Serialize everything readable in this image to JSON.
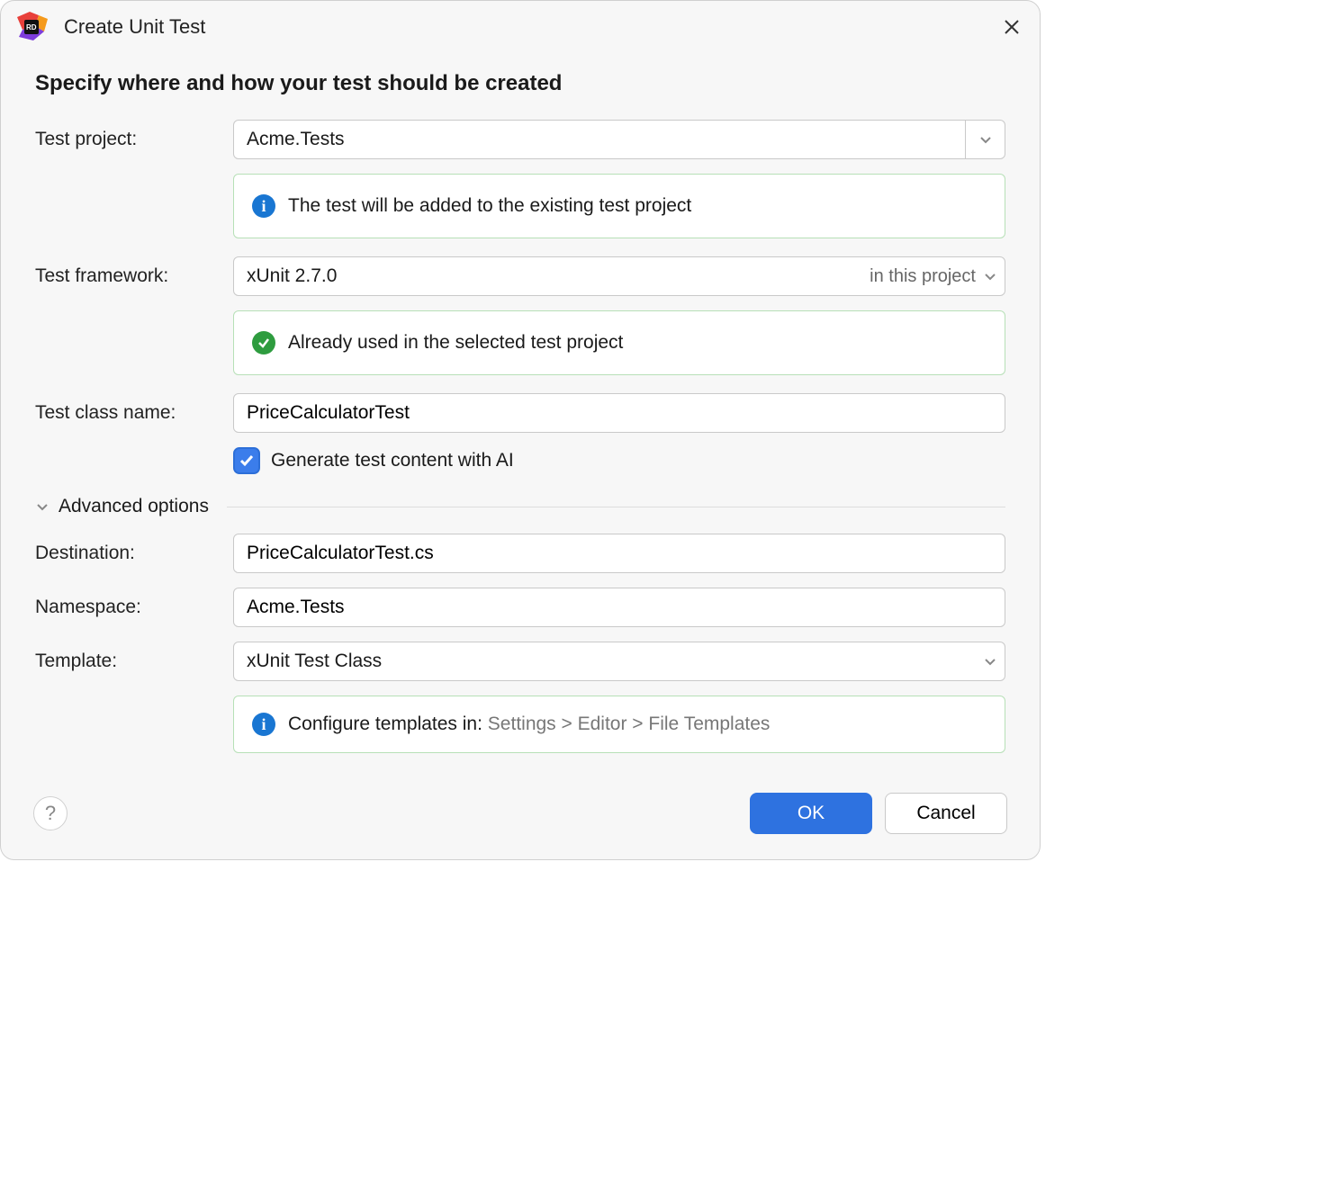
{
  "title": "Create Unit Test",
  "heading": "Specify where and how your test should be created",
  "labels": {
    "test_project": "Test project:",
    "test_framework": "Test framework:",
    "test_class_name": "Test class name:",
    "destination": "Destination:",
    "namespace": "Namespace:",
    "template": "Template:"
  },
  "fields": {
    "test_project": "Acme.Tests",
    "framework": "xUnit 2.7.0",
    "framework_scope": "in this project",
    "class_name": "PriceCalculatorTest",
    "destination": "PriceCalculatorTest.cs",
    "namespace": "Acme.Tests",
    "template": "xUnit Test Class"
  },
  "hints": {
    "existing_project": "The test will be added to the existing test project",
    "framework_used": "Already used in the selected test project",
    "configure_prefix": "Configure templates in: ",
    "configure_path": "Settings > Editor > File Templates"
  },
  "checkbox": {
    "ai_label": "Generate test content with AI",
    "ai_checked": true
  },
  "advanced_label": "Advanced options",
  "buttons": {
    "ok": "OK",
    "cancel": "Cancel"
  }
}
